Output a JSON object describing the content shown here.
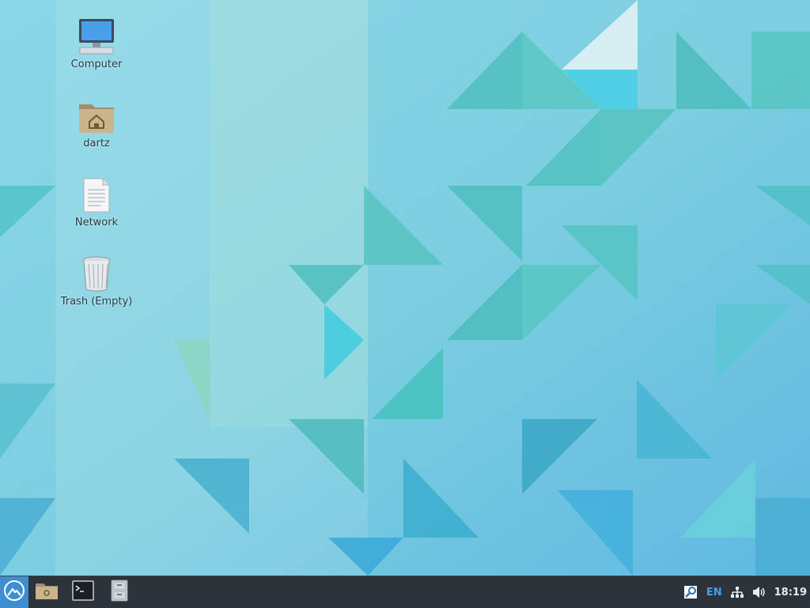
{
  "desktop": {
    "icons": [
      {
        "name": "computer",
        "label": "Computer",
        "icon": "computer-icon"
      },
      {
        "name": "home",
        "label": "dartz",
        "icon": "home-folder-icon"
      },
      {
        "name": "network",
        "label": "Network",
        "icon": "document-icon"
      },
      {
        "name": "trash",
        "label": "Trash (Empty)",
        "icon": "trash-icon"
      }
    ]
  },
  "taskbar": {
    "start_icon": "mountain-logo-icon",
    "launchers": [
      {
        "name": "file-manager",
        "icon": "folder-icon"
      },
      {
        "name": "terminal",
        "icon": "terminal-icon"
      },
      {
        "name": "file-cabinet",
        "icon": "file-cabinet-icon"
      }
    ],
    "tray": {
      "search_icon": "search-icon",
      "language": "EN",
      "network_icon": "network-icon",
      "volume_icon": "volume-icon",
      "clock": "18:19"
    }
  },
  "colors": {
    "taskbar_bg": "#2d333b",
    "start_button": "#3d8fd3",
    "language_text": "#3ea0e8",
    "wallpaper_base": "#7fd0e3"
  }
}
